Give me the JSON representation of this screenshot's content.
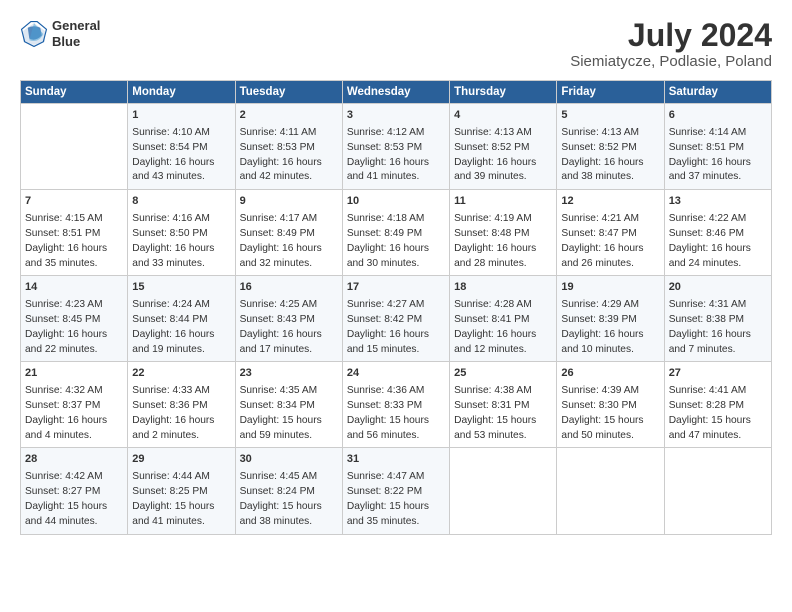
{
  "logo": {
    "line1": "General",
    "line2": "Blue"
  },
  "title": "July 2024",
  "subtitle": "Siemiatycze, Podlasie, Poland",
  "days_of_week": [
    "Sunday",
    "Monday",
    "Tuesday",
    "Wednesday",
    "Thursday",
    "Friday",
    "Saturday"
  ],
  "weeks": [
    [
      {
        "day": "",
        "content": ""
      },
      {
        "day": "1",
        "content": "Sunrise: 4:10 AM\nSunset: 8:54 PM\nDaylight: 16 hours\nand 43 minutes."
      },
      {
        "day": "2",
        "content": "Sunrise: 4:11 AM\nSunset: 8:53 PM\nDaylight: 16 hours\nand 42 minutes."
      },
      {
        "day": "3",
        "content": "Sunrise: 4:12 AM\nSunset: 8:53 PM\nDaylight: 16 hours\nand 41 minutes."
      },
      {
        "day": "4",
        "content": "Sunrise: 4:13 AM\nSunset: 8:52 PM\nDaylight: 16 hours\nand 39 minutes."
      },
      {
        "day": "5",
        "content": "Sunrise: 4:13 AM\nSunset: 8:52 PM\nDaylight: 16 hours\nand 38 minutes."
      },
      {
        "day": "6",
        "content": "Sunrise: 4:14 AM\nSunset: 8:51 PM\nDaylight: 16 hours\nand 37 minutes."
      }
    ],
    [
      {
        "day": "7",
        "content": "Sunrise: 4:15 AM\nSunset: 8:51 PM\nDaylight: 16 hours\nand 35 minutes."
      },
      {
        "day": "8",
        "content": "Sunrise: 4:16 AM\nSunset: 8:50 PM\nDaylight: 16 hours\nand 33 minutes."
      },
      {
        "day": "9",
        "content": "Sunrise: 4:17 AM\nSunset: 8:49 PM\nDaylight: 16 hours\nand 32 minutes."
      },
      {
        "day": "10",
        "content": "Sunrise: 4:18 AM\nSunset: 8:49 PM\nDaylight: 16 hours\nand 30 minutes."
      },
      {
        "day": "11",
        "content": "Sunrise: 4:19 AM\nSunset: 8:48 PM\nDaylight: 16 hours\nand 28 minutes."
      },
      {
        "day": "12",
        "content": "Sunrise: 4:21 AM\nSunset: 8:47 PM\nDaylight: 16 hours\nand 26 minutes."
      },
      {
        "day": "13",
        "content": "Sunrise: 4:22 AM\nSunset: 8:46 PM\nDaylight: 16 hours\nand 24 minutes."
      }
    ],
    [
      {
        "day": "14",
        "content": "Sunrise: 4:23 AM\nSunset: 8:45 PM\nDaylight: 16 hours\nand 22 minutes."
      },
      {
        "day": "15",
        "content": "Sunrise: 4:24 AM\nSunset: 8:44 PM\nDaylight: 16 hours\nand 19 minutes."
      },
      {
        "day": "16",
        "content": "Sunrise: 4:25 AM\nSunset: 8:43 PM\nDaylight: 16 hours\nand 17 minutes."
      },
      {
        "day": "17",
        "content": "Sunrise: 4:27 AM\nSunset: 8:42 PM\nDaylight: 16 hours\nand 15 minutes."
      },
      {
        "day": "18",
        "content": "Sunrise: 4:28 AM\nSunset: 8:41 PM\nDaylight: 16 hours\nand 12 minutes."
      },
      {
        "day": "19",
        "content": "Sunrise: 4:29 AM\nSunset: 8:39 PM\nDaylight: 16 hours\nand 10 minutes."
      },
      {
        "day": "20",
        "content": "Sunrise: 4:31 AM\nSunset: 8:38 PM\nDaylight: 16 hours\nand 7 minutes."
      }
    ],
    [
      {
        "day": "21",
        "content": "Sunrise: 4:32 AM\nSunset: 8:37 PM\nDaylight: 16 hours\nand 4 minutes."
      },
      {
        "day": "22",
        "content": "Sunrise: 4:33 AM\nSunset: 8:36 PM\nDaylight: 16 hours\nand 2 minutes."
      },
      {
        "day": "23",
        "content": "Sunrise: 4:35 AM\nSunset: 8:34 PM\nDaylight: 15 hours\nand 59 minutes."
      },
      {
        "day": "24",
        "content": "Sunrise: 4:36 AM\nSunset: 8:33 PM\nDaylight: 15 hours\nand 56 minutes."
      },
      {
        "day": "25",
        "content": "Sunrise: 4:38 AM\nSunset: 8:31 PM\nDaylight: 15 hours\nand 53 minutes."
      },
      {
        "day": "26",
        "content": "Sunrise: 4:39 AM\nSunset: 8:30 PM\nDaylight: 15 hours\nand 50 minutes."
      },
      {
        "day": "27",
        "content": "Sunrise: 4:41 AM\nSunset: 8:28 PM\nDaylight: 15 hours\nand 47 minutes."
      }
    ],
    [
      {
        "day": "28",
        "content": "Sunrise: 4:42 AM\nSunset: 8:27 PM\nDaylight: 15 hours\nand 44 minutes."
      },
      {
        "day": "29",
        "content": "Sunrise: 4:44 AM\nSunset: 8:25 PM\nDaylight: 15 hours\nand 41 minutes."
      },
      {
        "day": "30",
        "content": "Sunrise: 4:45 AM\nSunset: 8:24 PM\nDaylight: 15 hours\nand 38 minutes."
      },
      {
        "day": "31",
        "content": "Sunrise: 4:47 AM\nSunset: 8:22 PM\nDaylight: 15 hours\nand 35 minutes."
      },
      {
        "day": "",
        "content": ""
      },
      {
        "day": "",
        "content": ""
      },
      {
        "day": "",
        "content": ""
      }
    ]
  ]
}
